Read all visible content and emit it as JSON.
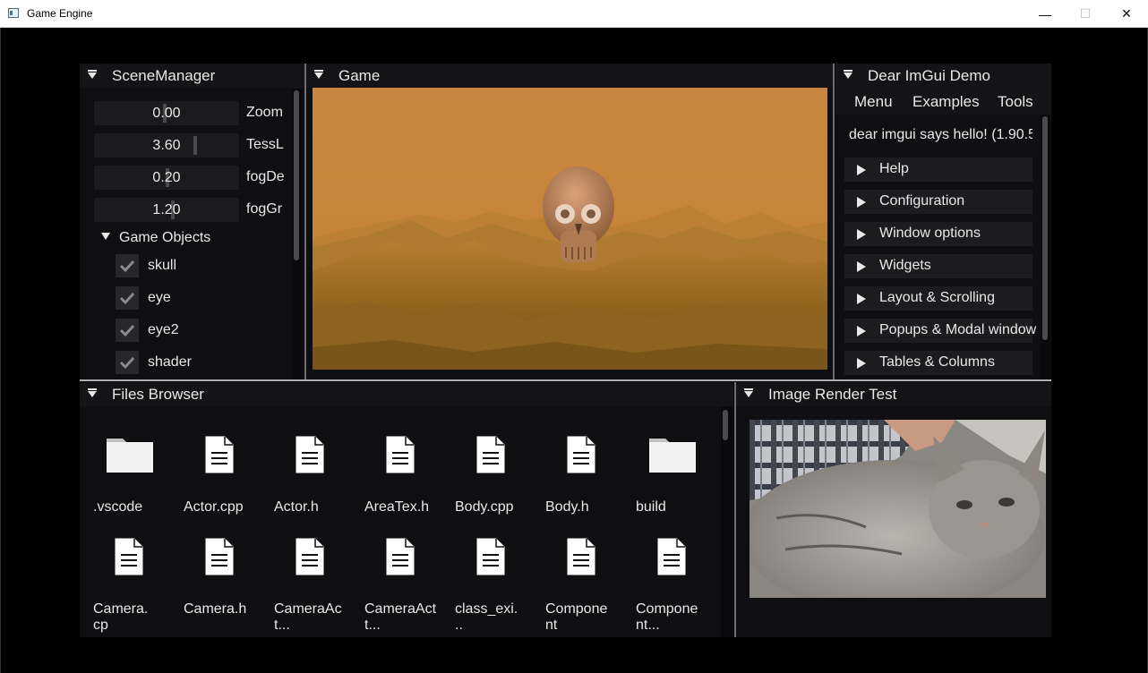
{
  "window": {
    "title": "Game Engine",
    "minimize": "—",
    "maximize": "☐",
    "close": "✕"
  },
  "scene_manager": {
    "title": "SceneManager",
    "sliders": [
      {
        "value": "0.00",
        "label": "Zoom",
        "level": 0.5
      },
      {
        "value": "3.60",
        "label": "TessL",
        "level": 0.72
      },
      {
        "value": "0.20",
        "label": "fogDe",
        "level": 0.52
      },
      {
        "value": "1.20",
        "label": "fogGr",
        "level": 0.56
      }
    ],
    "game_objects": {
      "label": "Game Objects",
      "items": [
        {
          "name": "skull",
          "checked": true
        },
        {
          "name": "eye",
          "checked": true
        },
        {
          "name": "eye2",
          "checked": true
        },
        {
          "name": "shader",
          "checked": true
        }
      ]
    }
  },
  "game": {
    "title": "Game"
  },
  "imgui_demo": {
    "title": "Dear ImGui Demo",
    "menu": [
      "Menu",
      "Examples",
      "Tools"
    ],
    "hello_text": "dear imgui says hello! (1.90.5",
    "headers": [
      "Help",
      "Configuration",
      "Window options",
      "Widgets",
      "Layout & Scrolling",
      "Popups & Modal window",
      "Tables & Columns"
    ]
  },
  "files_browser": {
    "title": "Files Browser",
    "files": [
      {
        "name": ".vscode",
        "icon": "folder-icon"
      },
      {
        "name": "Actor.cpp",
        "icon": "file-icon"
      },
      {
        "name": "Actor.h",
        "icon": "file-icon"
      },
      {
        "name": "AreaTex.h",
        "icon": "file-icon"
      },
      {
        "name": "Body.cpp",
        "icon": "file-icon"
      },
      {
        "name": "Body.h",
        "icon": "file-icon"
      },
      {
        "name": "build",
        "icon": "folder-icon"
      },
      {
        "name": "Camera.\ncp",
        "icon": "file-icon"
      },
      {
        "name": "Camera.h",
        "icon": "file-icon"
      },
      {
        "name": "CameraAc\nt...",
        "icon": "file-icon"
      },
      {
        "name": "CameraAct\nt...",
        "icon": "file-icon"
      },
      {
        "name": "class_exi.\n..",
        "icon": "file-icon"
      },
      {
        "name": "Compone\nnt",
        "icon": "file-icon"
      },
      {
        "name": "Compone\nnt...",
        "icon": "file-icon"
      }
    ]
  },
  "image_render": {
    "title": "Image Render Test"
  },
  "colors": {
    "game_sky": "#c8873d",
    "terrain": "#a8782c",
    "panel_bg": "#0f0f12"
  }
}
